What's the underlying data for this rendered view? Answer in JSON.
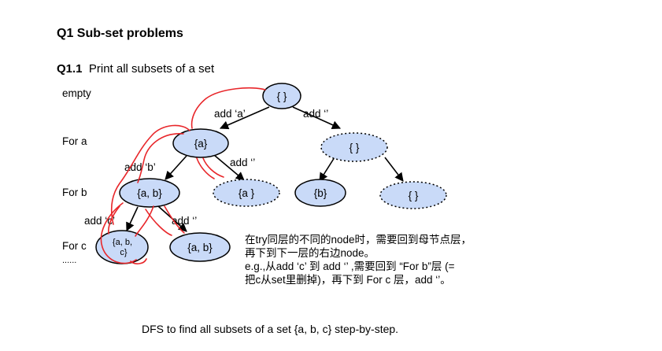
{
  "heading": "Q1  Sub-set problems",
  "subheading": {
    "number": "Q1.1",
    "text": "Print all subsets of a set"
  },
  "levels": [
    "empty",
    "For a",
    "For b",
    "For c",
    "......"
  ],
  "tree": {
    "nodes": [
      {
        "id": "root",
        "label": "{ }",
        "style": "solid"
      },
      {
        "id": "a",
        "label": "{a}",
        "style": "solid"
      },
      {
        "id": "empty1",
        "label": "{ }",
        "style": "dotted"
      },
      {
        "id": "ab",
        "label": "{a, b}",
        "style": "solid"
      },
      {
        "id": "a2",
        "label": "{a }",
        "style": "dotted"
      },
      {
        "id": "b",
        "label": "{b}",
        "style": "solid"
      },
      {
        "id": "empty2",
        "label": "{ }",
        "style": "dotted"
      },
      {
        "id": "abc",
        "label": "{a, b,\nc}",
        "style": "solid"
      },
      {
        "id": "ab2",
        "label": "{a, b}",
        "style": "solid"
      }
    ],
    "edges": [
      {
        "from": "root",
        "to": "a",
        "label": "add ‘a’"
      },
      {
        "from": "root",
        "to": "empty1",
        "label": "add ‘’"
      },
      {
        "from": "a",
        "to": "ab",
        "label": "add ‘b’"
      },
      {
        "from": "a",
        "to": "a2",
        "label": "add ‘’"
      },
      {
        "from": "empty1",
        "to": "b",
        "label": ""
      },
      {
        "from": "empty1",
        "to": "empty2",
        "label": ""
      },
      {
        "from": "ab",
        "to": "abc",
        "label": "add ‘c’"
      },
      {
        "from": "ab",
        "to": "ab2",
        "label": "add ‘’"
      }
    ]
  },
  "note": [
    "在try同层的不同的node时，需要回到母节点层，",
    "再下到下一层的右边node。",
    "e.g.,从add ‘c’ 到 add ‘’ ,需要回到 “For b”层 (=",
    "把c从set里删掉)，再下到 For c 层，add ‘’。"
  ],
  "caption": "DFS to find all subsets of a set {a, b, c}  step-by-step.",
  "colors": {
    "node_fill": "#c9daf8",
    "node_stroke": "#000000",
    "trace": "#e8262a"
  }
}
